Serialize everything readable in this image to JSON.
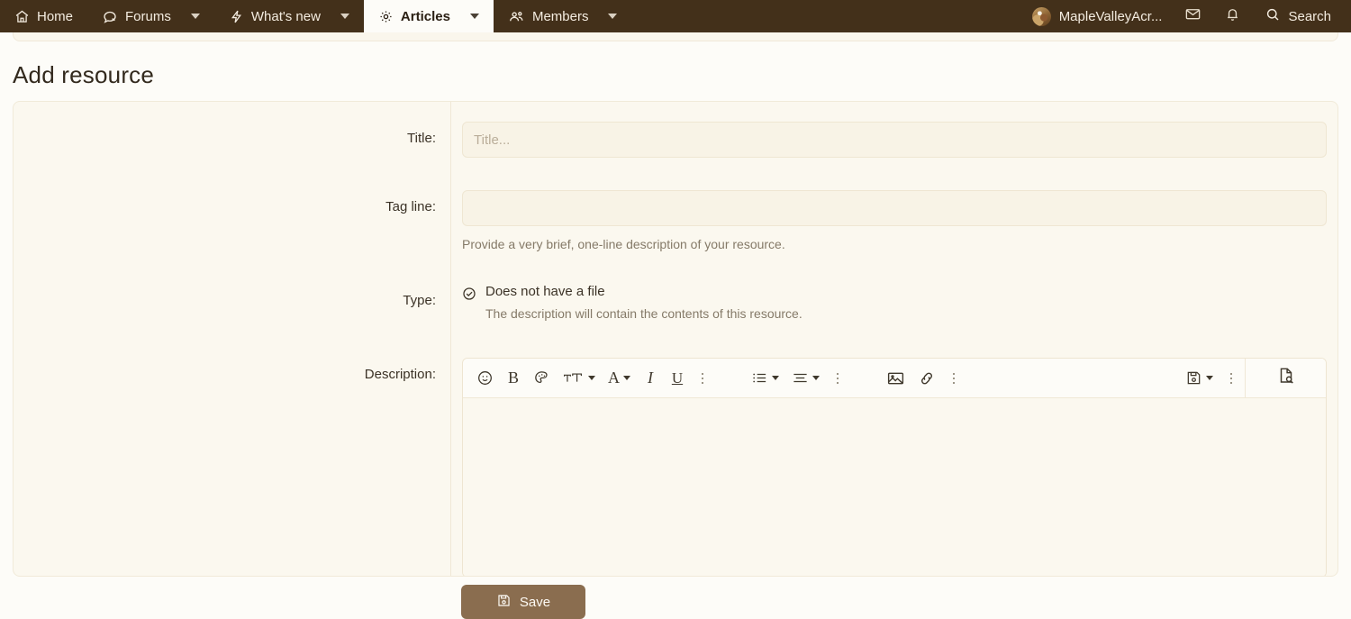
{
  "theme": {
    "navbar_bg": "#43301a",
    "page_bg": "#fdfcf8",
    "panel_bg": "#fbf8ef",
    "input_bg": "#f8f3e6",
    "accent_button": "#8a6d4f",
    "text": "#3b3226",
    "muted_text": "#857a68"
  },
  "navbar": {
    "items": [
      {
        "label": "Home",
        "icon": "home-icon",
        "has_caret": false,
        "active": false
      },
      {
        "label": "Forums",
        "icon": "forums-icon",
        "has_caret": true,
        "active": false
      },
      {
        "label": "What's new",
        "icon": "bolt-icon",
        "has_caret": true,
        "active": false
      },
      {
        "label": "Articles",
        "icon": "gear-icon",
        "has_caret": true,
        "active": true
      },
      {
        "label": "Members",
        "icon": "members-icon",
        "has_caret": true,
        "active": false
      }
    ],
    "user": {
      "name": "MapleValleyAcr...",
      "avatar": "user-avatar"
    },
    "inbox_icon": "envelope-icon",
    "alerts_icon": "bell-icon",
    "search": {
      "label": "Search",
      "icon": "search-icon"
    }
  },
  "page": {
    "title": "Add resource"
  },
  "form": {
    "title_row": {
      "label": "Title:",
      "value": "",
      "placeholder": "Title..."
    },
    "tagline_row": {
      "label": "Tag line:",
      "value": "",
      "placeholder": "",
      "hint": "Provide a very brief, one-line description of your resource."
    },
    "type_row": {
      "label": "Type:",
      "option_icon": "check-circle-icon",
      "option_label": "Does not have a file",
      "option_sub": "The description will contain the contents of this resource."
    },
    "description_row": {
      "label": "Description:",
      "value": "",
      "toolbar": {
        "group1": [
          {
            "name": "emoji-icon",
            "label": "",
            "caret": false
          },
          {
            "name": "bold-icon",
            "label": "B",
            "caret": false
          },
          {
            "name": "palette-icon",
            "label": "",
            "caret": false
          },
          {
            "name": "font-size-icon",
            "label": "",
            "caret": true
          },
          {
            "name": "text-color-icon",
            "label": "A",
            "caret": true
          },
          {
            "name": "italic-icon",
            "label": "I",
            "caret": false
          },
          {
            "name": "underline-icon",
            "label": "U",
            "caret": false
          }
        ],
        "group1_more": "more-options-icon",
        "group2": [
          {
            "name": "bullet-list-icon",
            "label": "",
            "caret": true
          },
          {
            "name": "align-icon",
            "label": "",
            "caret": true
          }
        ],
        "group2_more": "more-options-icon",
        "group3": [
          {
            "name": "insert-image-icon",
            "label": "",
            "caret": false
          },
          {
            "name": "insert-link-icon",
            "label": "",
            "caret": false
          }
        ],
        "group3_more": "more-options-icon",
        "group4": [
          {
            "name": "drafts-icon",
            "label": "",
            "caret": true
          }
        ],
        "group4_more": "more-options-icon",
        "preview": {
          "name": "preview-icon",
          "label": ""
        }
      }
    },
    "save_button": {
      "label": "Save",
      "icon": "floppy-disk-icon"
    }
  }
}
